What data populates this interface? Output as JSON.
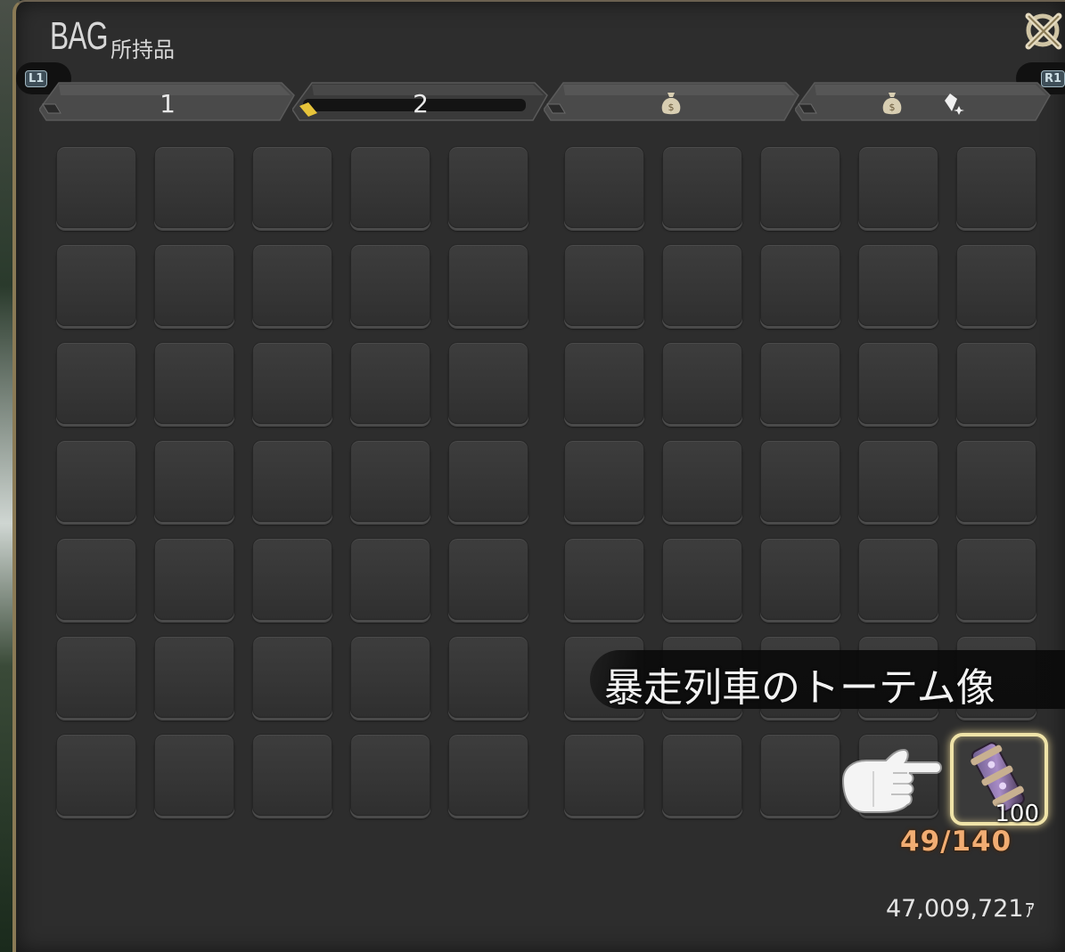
{
  "window": {
    "title": "BAG",
    "subtitle": "所持品"
  },
  "shoulder_buttons": {
    "left": "L1",
    "right": "R1"
  },
  "tabs": [
    {
      "label": "1",
      "active": false
    },
    {
      "label": "2",
      "active": true
    },
    {
      "label": "",
      "icon": "money-bag-icon",
      "active": false
    },
    {
      "label": "",
      "icon": "money-bag-crystal-icon",
      "active": false
    }
  ],
  "grid": {
    "rows": 7,
    "columns_per_block": 5,
    "blocks": 2
  },
  "tooltip": {
    "item_name": "暴走列車のトーテム像"
  },
  "selected_item": {
    "icon": "totem-statue-icon",
    "count": "100"
  },
  "capacity": "49/140",
  "gil": "47,009,721ｧ",
  "colors": {
    "panel": "#2d2d2d",
    "slot": "#3a3a3a",
    "capacity_text": "#f1ad73",
    "selection_glow": "#efe3a8",
    "active_tab_marker": "#e7c43a"
  }
}
